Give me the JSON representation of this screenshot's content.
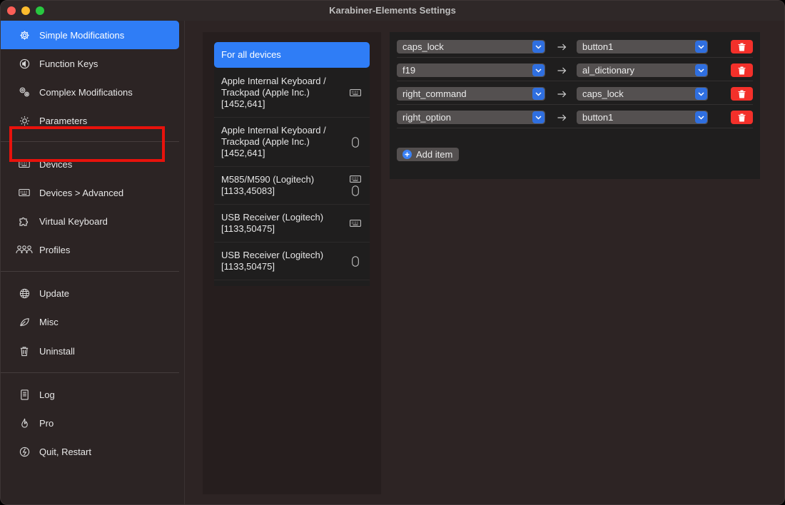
{
  "window": {
    "title": "Karabiner-Elements Settings"
  },
  "sidebar": {
    "items": [
      {
        "label": "Simple Modifications",
        "icon": "gear-icon"
      },
      {
        "label": "Function Keys",
        "icon": "speaker-icon"
      },
      {
        "label": "Complex Modifications",
        "icon": "gears-icon"
      },
      {
        "label": "Parameters",
        "icon": "sun-icon"
      },
      {
        "label": "Devices",
        "icon": "keyboard-icon"
      },
      {
        "label": "Devices > Advanced",
        "icon": "keyboard-icon"
      },
      {
        "label": "Virtual Keyboard",
        "icon": "puzzle-icon"
      },
      {
        "label": "Profiles",
        "icon": "people-icon"
      },
      {
        "label": "Update",
        "icon": "globe-icon"
      },
      {
        "label": "Misc",
        "icon": "leaf-icon"
      },
      {
        "label": "Uninstall",
        "icon": "trash-icon"
      },
      {
        "label": "Log",
        "icon": "document-icon"
      },
      {
        "label": "Pro",
        "icon": "flame-icon"
      },
      {
        "label": "Quit, Restart",
        "icon": "power-icon"
      }
    ]
  },
  "devices": [
    {
      "name": "For all devices"
    },
    {
      "name": "Apple Internal Keyboard / Trackpad (Apple Inc.) [1452,641]"
    },
    {
      "name": "Apple Internal Keyboard / Trackpad (Apple Inc.) [1452,641]"
    },
    {
      "name": "M585/M590 (Logitech) [1133,45083]"
    },
    {
      "name": "USB Receiver (Logitech) [1133,50475]"
    },
    {
      "name": "USB Receiver (Logitech) [1133,50475]"
    }
  ],
  "mappings": [
    {
      "from": "caps_lock",
      "to": "button1"
    },
    {
      "from": "f19",
      "to": "al_dictionary"
    },
    {
      "from": "right_command",
      "to": "caps_lock"
    },
    {
      "from": "right_option",
      "to": "button1"
    }
  ],
  "add_item_label": "Add item",
  "colors": {
    "accent": "#2f7df6",
    "delete": "#f3302a",
    "highlight": "#e8120c"
  }
}
